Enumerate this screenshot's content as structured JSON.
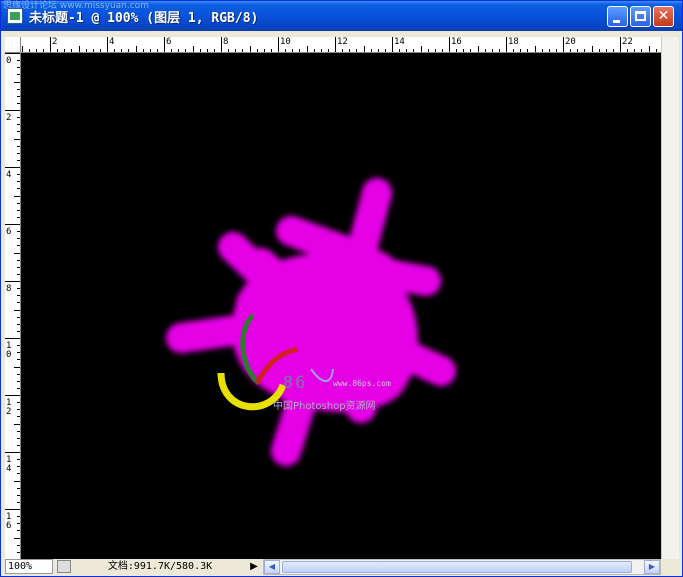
{
  "window": {
    "title": "未标题-1 @ 100% (图层 1, RGB/8)",
    "watermark_top": "思缘设计论坛 www.missyuan.com"
  },
  "ruler": {
    "h_labels": [
      "2",
      "4",
      "6",
      "8",
      "10",
      "12",
      "14",
      "16",
      "18",
      "20",
      "22"
    ],
    "v_labels": [
      "0",
      "2",
      "4",
      "6",
      "8",
      "10",
      "12",
      "14",
      "16"
    ]
  },
  "canvas": {
    "background": "#000000",
    "paint_color": "#e600e6",
    "logo": {
      "number": "86",
      "url": "www.86ps.com",
      "caption": "中国Photoshop资源网"
    }
  },
  "status": {
    "zoom": "100%",
    "doc_info": "文档:991.7K/580.3K",
    "menu_arrow": "▶"
  },
  "scroll": {
    "left_arrow": "◀",
    "right_arrow": "▶",
    "grip": "⠿"
  },
  "buttons": {
    "close_glyph": "✕"
  }
}
